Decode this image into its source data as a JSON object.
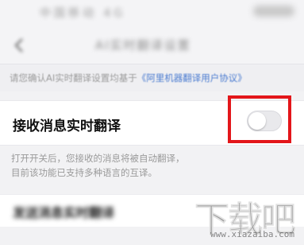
{
  "status_bar": {
    "blurred_text": "中国移动 4G"
  },
  "nav": {
    "title": "AI实时翻译设置"
  },
  "notice": {
    "text": "请您确认AI实时翻译设置均基于",
    "link_text": "《阿里机器翻译用户协议》"
  },
  "receive": {
    "label": "接收消息实时翻译",
    "toggle_state": "off"
  },
  "description": {
    "line1": "打开开关后，您接收的消息将被自动翻译，",
    "line2": "目前该功能已支持多种语言的互译。"
  },
  "send": {
    "label": "发送消息实时翻译"
  },
  "watermark": {
    "brand": "下载吧",
    "url": "www.xiazaiba.com"
  },
  "colors": {
    "highlight": "#e3161a",
    "link": "#4a7bd0"
  }
}
